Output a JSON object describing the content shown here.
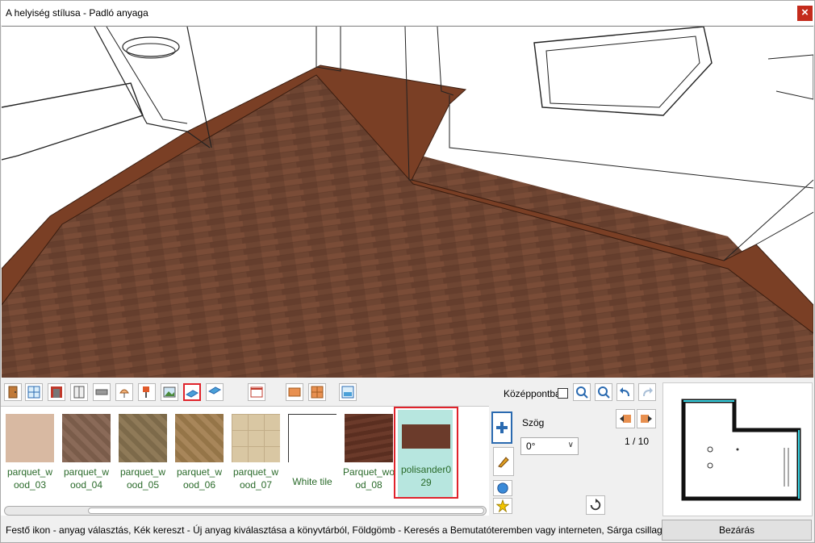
{
  "window": {
    "title": "A helyiség stílusa - Padló anyaga",
    "close_glyph": "×"
  },
  "toolbar": {
    "icons": [
      "door-icon",
      "window-icon",
      "wall-texture-icon",
      "cabinet-icon",
      "shelf-icon",
      "lamp-icon",
      "floor-lamp-icon",
      "picture-icon",
      "floor-material-icon",
      "ceiling-material-icon",
      "curtain-icon",
      "tile-icon",
      "tile-grid-icon",
      "paint-roller-icon"
    ],
    "center_label": "Középpontba"
  },
  "materials": [
    {
      "label": "parquet_w\nood_03",
      "color": "#d8b9a2"
    },
    {
      "label": "parquet_w\nood_04",
      "color": "#8a6a58"
    },
    {
      "label": "parquet_w\nood_05",
      "color": "#8f7a58"
    },
    {
      "label": "parquet_w\nood_06",
      "color": "#a8865a"
    },
    {
      "label": "parquet_w\nood_07",
      "color": "#d9c7a3"
    },
    {
      "label": "White tile",
      "color": "#ffffff"
    },
    {
      "label": "Parquet_wo\nod_08",
      "color": "#6b3a2a"
    },
    {
      "label": "polisander0\n29",
      "color": "#6b3b2b",
      "selected": true
    }
  ],
  "angle": {
    "label": "Szög",
    "value": "0°"
  },
  "page_indicator": "1 / 10",
  "status_text": "Festő ikon - anyag választás, Kék kereszt - Új anyag kiválasztása a könyvtárból, Földgömb - Keresés a Bemutatóteremben vagy interneten, Sárga csillag - új anyag",
  "close_button": "Bezárás"
}
